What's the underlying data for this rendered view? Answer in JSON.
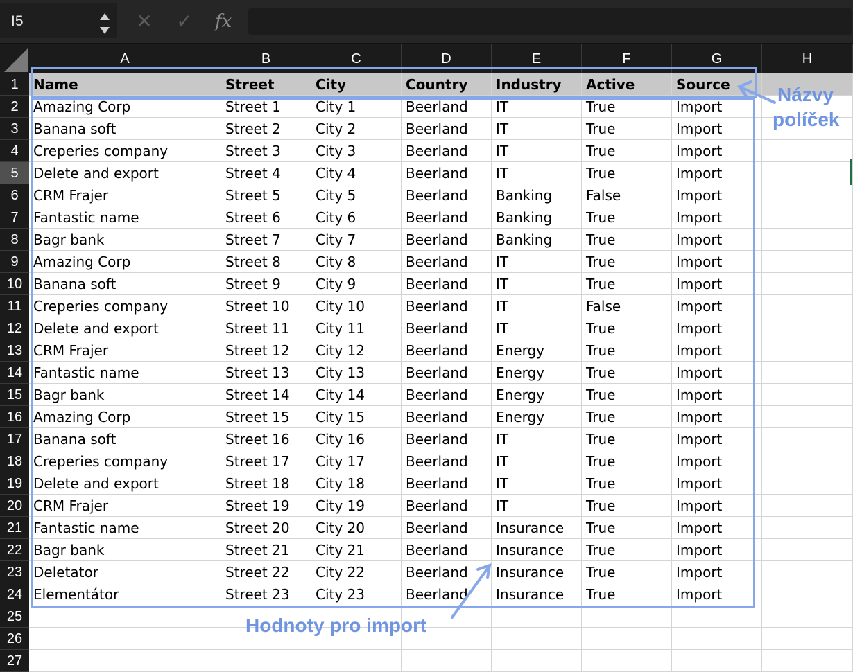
{
  "formula_bar": {
    "name_box": "I5",
    "cancel_glyph": "✕",
    "confirm_glyph": "✓",
    "fx_label": "fx",
    "formula_value": ""
  },
  "columns": [
    "A",
    "B",
    "C",
    "D",
    "E",
    "F",
    "G",
    "H"
  ],
  "row_numbers": [
    "1",
    "2",
    "3",
    "4",
    "5",
    "6",
    "7",
    "8",
    "9",
    "10",
    "11",
    "12",
    "13",
    "14",
    "15",
    "16",
    "17",
    "18",
    "19",
    "20",
    "21",
    "22",
    "23",
    "24",
    "25",
    "26",
    "27"
  ],
  "selected_row": "5",
  "sheet": {
    "header": [
      "Name",
      "Street",
      "City",
      "Country",
      "Industry",
      "Active",
      "Source"
    ],
    "rows": [
      [
        "Amazing Corp",
        "Street 1",
        "City 1",
        "Beerland",
        "IT",
        "True",
        "Import"
      ],
      [
        "Banana soft",
        "Street 2",
        "City 2",
        "Beerland",
        "IT",
        "True",
        "Import"
      ],
      [
        "Creperies company",
        "Street 3",
        "City 3",
        "Beerland",
        "IT",
        "True",
        "Import"
      ],
      [
        "Delete and export",
        "Street 4",
        "City 4",
        "Beerland",
        "IT",
        "True",
        "Import"
      ],
      [
        "CRM Frajer",
        "Street 5",
        "City 5",
        "Beerland",
        "Banking",
        "False",
        "Import"
      ],
      [
        "Fantastic name",
        "Street 6",
        "City 6",
        "Beerland",
        "Banking",
        "True",
        "Import"
      ],
      [
        "Bagr bank",
        "Street 7",
        "City 7",
        "Beerland",
        "Banking",
        "True",
        "Import"
      ],
      [
        "Amazing Corp",
        "Street 8",
        "City 8",
        "Beerland",
        "IT",
        "True",
        "Import"
      ],
      [
        "Banana soft",
        "Street 9",
        "City 9",
        "Beerland",
        "IT",
        "True",
        "Import"
      ],
      [
        "Creperies company",
        "Street 10",
        "City 10",
        "Beerland",
        "IT",
        "False",
        "Import"
      ],
      [
        "Delete and export",
        "Street 11",
        "City 11",
        "Beerland",
        "IT",
        "True",
        "Import"
      ],
      [
        "CRM Frajer",
        "Street 12",
        "City 12",
        "Beerland",
        "Energy",
        "True",
        "Import"
      ],
      [
        "Fantastic name",
        "Street 13",
        "City 13",
        "Beerland",
        "Energy",
        "True",
        "Import"
      ],
      [
        "Bagr bank",
        "Street 14",
        "City 14",
        "Beerland",
        "Energy",
        "True",
        "Import"
      ],
      [
        "Amazing Corp",
        "Street 15",
        "City 15",
        "Beerland",
        "Energy",
        "True",
        "Import"
      ],
      [
        "Banana soft",
        "Street 16",
        "City 16",
        "Beerland",
        "IT",
        "True",
        "Import"
      ],
      [
        "Creperies company",
        "Street 17",
        "City 17",
        "Beerland",
        "IT",
        "True",
        "Import"
      ],
      [
        "Delete and export",
        "Street 18",
        "City 18",
        "Beerland",
        "IT",
        "True",
        "Import"
      ],
      [
        "CRM Frajer",
        "Street 19",
        "City 19",
        "Beerland",
        "IT",
        "True",
        "Import"
      ],
      [
        "Fantastic name",
        "Street 20",
        "City 20",
        "Beerland",
        "Insurance",
        "True",
        "Import"
      ],
      [
        "Bagr bank",
        "Street 21",
        "City 21",
        "Beerland",
        "Insurance",
        "True",
        "Import"
      ],
      [
        "Deletator",
        "Street 22",
        "City 22",
        "Beerland",
        "Insurance",
        "True",
        "Import"
      ],
      [
        "Elementátor",
        "Street 23",
        "City 23",
        "Beerland",
        "Insurance",
        "True",
        "Import"
      ]
    ]
  },
  "annotations": {
    "field_names_line1": "Názvy",
    "field_names_line2": "políček",
    "import_values": "Hodnoty pro import",
    "color": "#86a8ea"
  },
  "colors": {
    "header_fill": "#c8c8c8",
    "toolbar_bg": "#262626",
    "gridline": "#d4d4d4",
    "selection_marker": "#1e7145"
  }
}
